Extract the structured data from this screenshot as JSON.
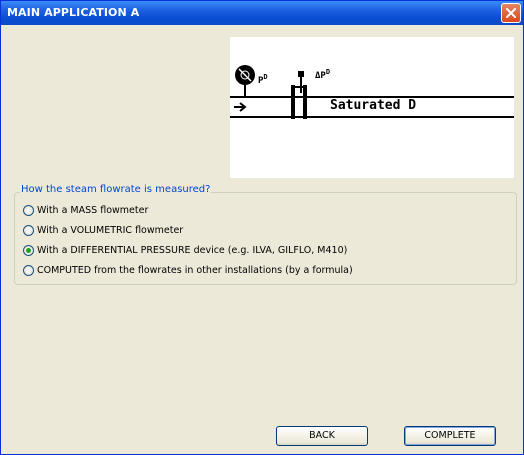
{
  "window": {
    "title": "MAIN APPLICATION A",
    "close_icon": "close-icon"
  },
  "diagram": {
    "pressure_label": "P",
    "pressure_sub": "D",
    "dp_label": "ΔP",
    "dp_sub": "D",
    "steam_state_label": "Saturated D"
  },
  "question": {
    "legend": "How the steam flowrate is measured?",
    "options": [
      {
        "label": "With a MASS flowmeter",
        "selected": false
      },
      {
        "label": "With a VOLUMETRIC flowmeter",
        "selected": false
      },
      {
        "label": "With a DIFFERENTIAL PRESSURE device (e.g. ILVA, GILFLO, M410)",
        "selected": true
      },
      {
        "label": "COMPUTED from the flowrates in other installations (by a formula)",
        "selected": false
      }
    ]
  },
  "buttons": {
    "back": "BACK",
    "complete": "COMPLETE"
  },
  "colors": {
    "title_bar": "#0a4ed4",
    "legend_text": "#0046d5",
    "radio_selected": "#21a121"
  }
}
